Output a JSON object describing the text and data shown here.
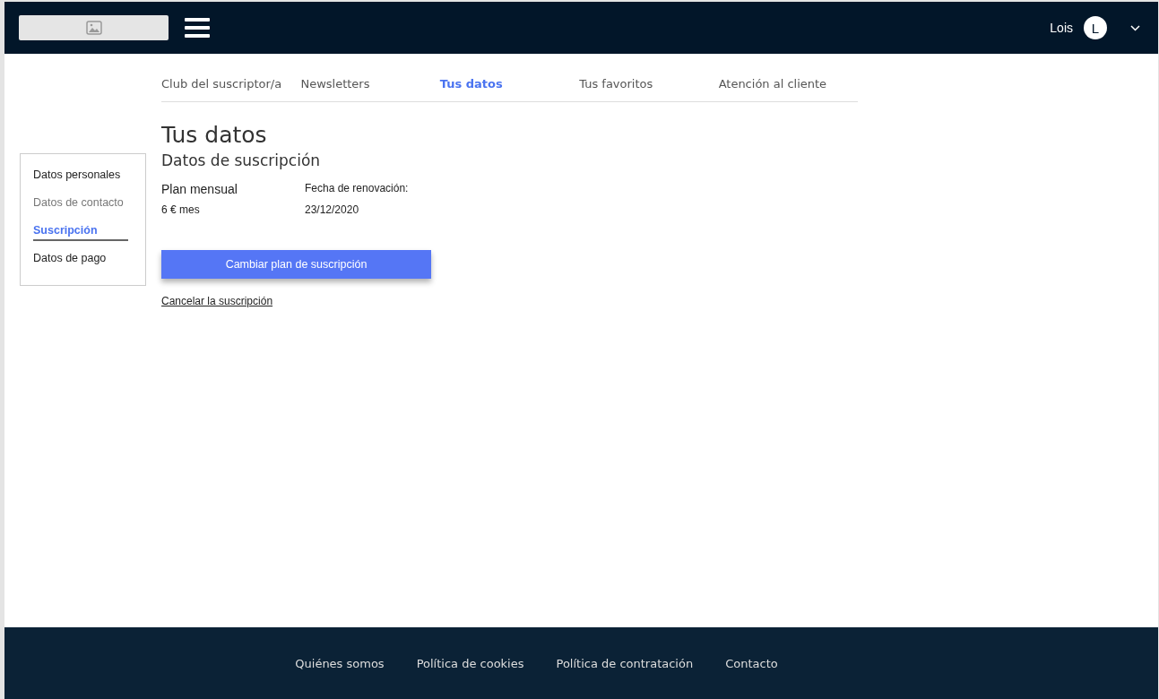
{
  "header": {
    "user_name": "Lois",
    "avatar_initial": "L"
  },
  "tabs": [
    {
      "label": "Club del suscriptor/a",
      "selected": false
    },
    {
      "label": "Newsletters",
      "selected": false
    },
    {
      "label": "Tus datos",
      "selected": true
    },
    {
      "label": "Tus favoritos",
      "selected": false
    },
    {
      "label": "Atención al cliente",
      "selected": false
    }
  ],
  "page_title": "Tus datos",
  "sidebar": {
    "items": [
      {
        "label": "Datos personales",
        "selected": false,
        "dimmed": false
      },
      {
        "label": "Datos de contacto",
        "selected": false,
        "dimmed": true
      },
      {
        "label": "Suscripción",
        "selected": true,
        "dimmed": false
      },
      {
        "label": "Datos de pago",
        "selected": false,
        "dimmed": false
      }
    ]
  },
  "subscription": {
    "heading": "Datos de suscripción",
    "plan_name": "Plan mensual",
    "plan_price": "6 € mes",
    "renewal_label": "Fecha de renovación:",
    "renewal_date": "23/12/2020",
    "change_button": "Cambiar plan de suscripción",
    "cancel_link": "Cancelar la suscripción"
  },
  "footer": {
    "links": [
      "Quiénes somos",
      "Política de cookies",
      "Política de contratación",
      "Contacto"
    ]
  }
}
